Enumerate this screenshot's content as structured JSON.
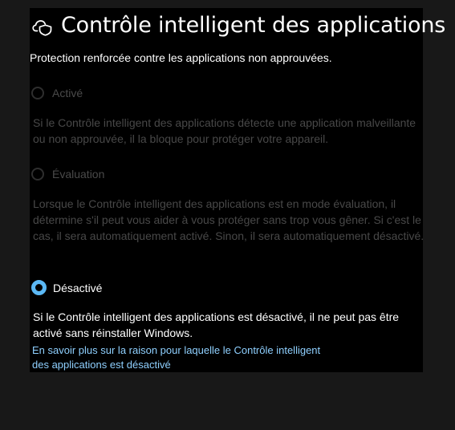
{
  "header": {
    "icon": "cloud-shield-icon",
    "title": "Contrôle intelligent des applications",
    "subtitle": "Protection renforcée contre les applications non approuvées."
  },
  "options": [
    {
      "label": "Activé",
      "description": "Si le Contrôle intelligent des applications détecte une application malveillante ou non approuvée, il la bloque pour protéger votre appareil.",
      "selected": false,
      "enabled": false
    },
    {
      "label": "Évaluation",
      "description": "Lorsque le Contrôle intelligent des applications est en mode évaluation, il détermine s'il peut vous aider à vous protéger sans trop vous gêner. Si c'est le cas, il sera automatiquement activé. Sinon, il sera automatiquement désactivé.",
      "selected": false,
      "enabled": false
    },
    {
      "label": "Désactivé",
      "description": "Si le Contrôle intelligent des applications est désactivé, il ne peut pas être activé sans réinstaller Windows.",
      "selected": true,
      "enabled": true
    }
  ],
  "link": {
    "label": "En savoir plus sur la raison pour laquelle le Contrôle intelligent des applications est désactivé"
  },
  "colors": {
    "accent": "#5bb8f5",
    "link": "#8fd0ff",
    "panel_background": "#000000",
    "page_background": "#181818",
    "disabled_text": "#484848"
  }
}
